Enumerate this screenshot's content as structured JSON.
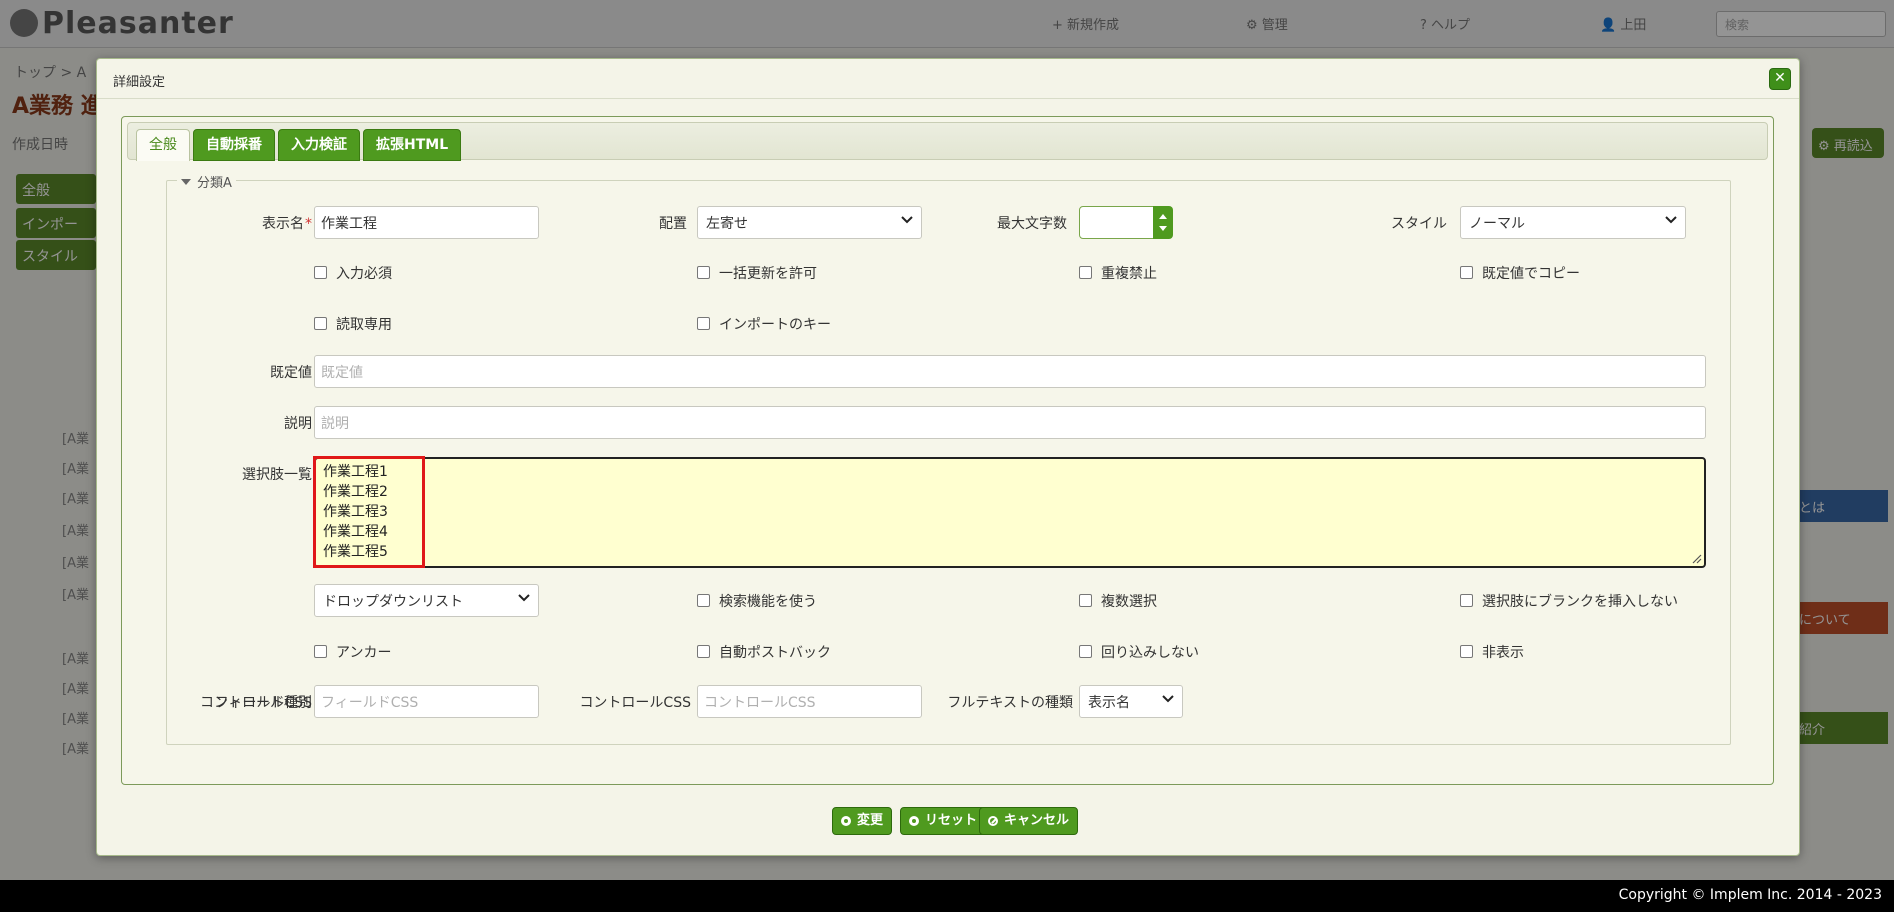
{
  "background": {
    "logo": "Pleasanter",
    "nav": [
      "+ 新規作成",
      "⚙ 管理",
      "? ヘルプ",
      "👤 上田"
    ],
    "search_placeholder": "検索",
    "breadcrumb": "トップ  >  A",
    "title": "A業務 進",
    "created": "作成日時",
    "side_tabs": [
      "全般",
      "インポー",
      "スタイル"
    ],
    "list_items": [
      "[A業",
      "[A業",
      "[A業",
      "[A業",
      "[A業",
      "[A業",
      "[A業",
      "[A業",
      "[A業",
      "[A業"
    ],
    "right_button": "⚙ 再読込",
    "right_panels": [
      "とは",
      "について",
      "紹介"
    ]
  },
  "dialog": {
    "title": "詳細設定",
    "close_icon": "close-icon",
    "tabs": [
      {
        "label": "全般",
        "active": true
      },
      {
        "label": "自動採番",
        "active": false
      },
      {
        "label": "入力検証",
        "active": false
      },
      {
        "label": "拡張HTML",
        "active": false
      }
    ],
    "fieldset_legend": "分類A",
    "fields": {
      "display_name": {
        "label": "表示名",
        "required_mark": "*",
        "value": "作業工程"
      },
      "alignment": {
        "label": "配置",
        "value": "左寄せ"
      },
      "max_length": {
        "label": "最大文字数",
        "value": ""
      },
      "style": {
        "label": "スタイル",
        "value": "ノーマル"
      },
      "default_value": {
        "label": "既定値",
        "placeholder": "既定値"
      },
      "description": {
        "label": "説明",
        "placeholder": "説明"
      },
      "choices": {
        "label": "選択肢一覧",
        "lines": [
          "作業工程1",
          "作業工程2",
          "作業工程3",
          "作業工程4",
          "作業工程5"
        ]
      },
      "control_type": {
        "label": "コントロール種別",
        "value": "ドロップダウンリスト"
      },
      "field_css": {
        "label": "フィールドCSS",
        "placeholder": "フィールドCSS"
      },
      "control_css": {
        "label": "コントロールCSS",
        "placeholder": "コントロールCSS"
      },
      "fulltext_type": {
        "label": "フルテキストの種類",
        "value": "表示名"
      }
    },
    "checkboxes": {
      "row1": [
        "入力必須",
        "一括更新を許可",
        "重複禁止",
        "既定値でコピー"
      ],
      "row2": [
        "読取専用",
        "インポートのキー"
      ],
      "row3": [
        "検索機能を使う",
        "複数選択",
        "選択肢にブランクを挿入しない"
      ],
      "row4": [
        "アンカー",
        "自動ポストバック",
        "回り込みしない",
        "非表示"
      ]
    },
    "buttons": {
      "change": "変更",
      "reset": "リセット",
      "cancel": "キャンセル"
    }
  },
  "footer": {
    "copyright": "Copyright © Implem Inc. 2014 - 2023"
  },
  "colors": {
    "accent_green": "#4f9a1f",
    "textarea_bg": "#ffffd0",
    "highlight_red": "#e01818"
  }
}
